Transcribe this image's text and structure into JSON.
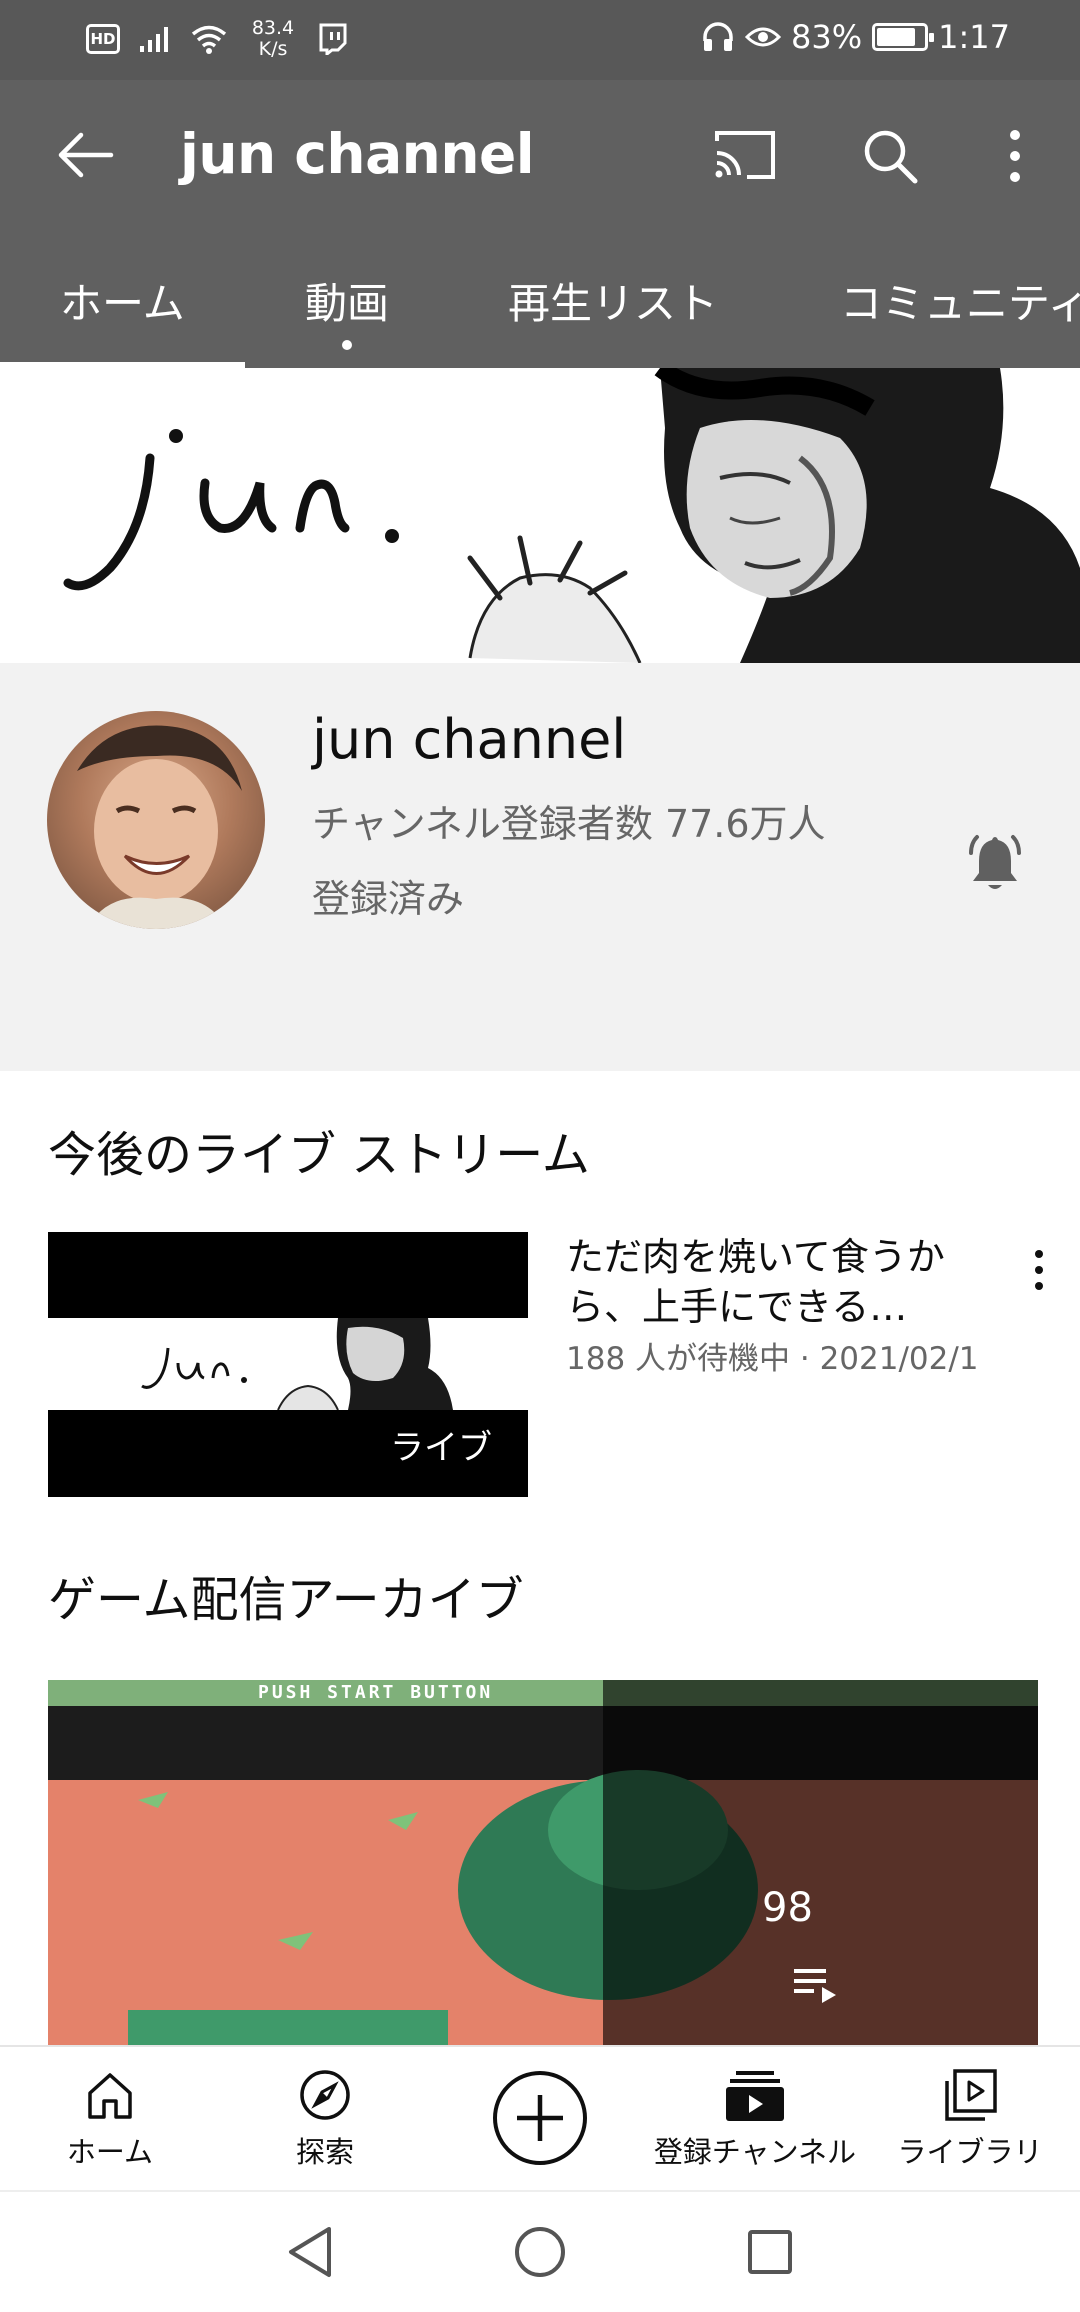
{
  "status_bar": {
    "hd": "HD",
    "speed_value": "83.4",
    "speed_unit": "K/s",
    "battery": "83%",
    "battery_level": 0.83,
    "time": "1:17"
  },
  "appbar": {
    "title": "jun channel"
  },
  "tabs": [
    {
      "label": "ホーム",
      "active": true
    },
    {
      "label": "動画",
      "dot": true
    },
    {
      "label": "再生リスト"
    },
    {
      "label": "コミュニティ"
    }
  ],
  "banner": {
    "logo_text": "jun."
  },
  "channel": {
    "name": "jun channel",
    "subscribers": "チャンネル登録者数 77.6万人",
    "status": "登録済み"
  },
  "upcoming": {
    "heading": "今後のライブ ストリーム",
    "item": {
      "title": "ただ肉を焼いて食うから、上手にできる…",
      "meta": "188 人が待機中 · 2021/02/1",
      "badge": "ライブ",
      "thumb_logo": "jun."
    }
  },
  "archive": {
    "heading": "ゲーム配信アーカイブ",
    "count": "98",
    "game_text": "PUSH START BUTTON"
  },
  "bottom_nav": [
    {
      "label": "ホーム"
    },
    {
      "label": "探索"
    },
    {
      "label": ""
    },
    {
      "label": "登録チャンネル"
    },
    {
      "label": "ライブラリ"
    }
  ],
  "colors": {
    "app_bar": "#606060",
    "status_bar": "#585858",
    "channel_bg": "#f2f2f2",
    "secondary_text": "#666666"
  }
}
